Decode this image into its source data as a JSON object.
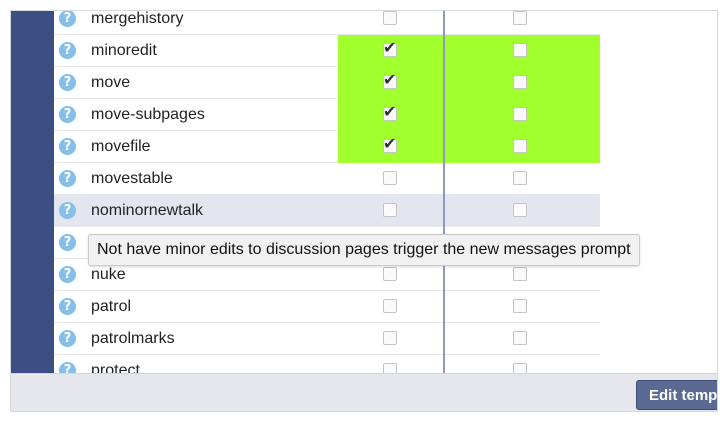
{
  "colors": {
    "granted": "#a1ff2e",
    "sidebar": "#3b4f85",
    "help_icon": "#85bfea"
  },
  "permissions": [
    {
      "name": "mergehistory",
      "col1": false,
      "col2": false,
      "granted": false
    },
    {
      "name": "minoredit",
      "col1": true,
      "col2": false,
      "granted": true
    },
    {
      "name": "move",
      "col1": true,
      "col2": false,
      "granted": true
    },
    {
      "name": "move-subpages",
      "col1": true,
      "col2": false,
      "granted": true
    },
    {
      "name": "movefile",
      "col1": true,
      "col2": false,
      "granted": true
    },
    {
      "name": "movestable",
      "col1": false,
      "col2": false,
      "granted": false
    },
    {
      "name": "nominornewtalk",
      "col1": false,
      "col2": false,
      "granted": false,
      "hover": true
    },
    {
      "name": "",
      "col1": false,
      "col2": false,
      "granted": false
    },
    {
      "name": "nuke",
      "col1": false,
      "col2": false,
      "granted": false
    },
    {
      "name": "patrol",
      "col1": false,
      "col2": false,
      "granted": false
    },
    {
      "name": "patrolmarks",
      "col1": false,
      "col2": false,
      "granted": false
    },
    {
      "name": "protect",
      "col1": false,
      "col2": false,
      "granted": false
    }
  ],
  "help_icon_glyph": "?",
  "help_icon_name": "question-mark-icon",
  "tooltip": "Not have minor edits to discussion pages trigger the new messages prompt",
  "footer": {
    "edit_button": "Edit temp"
  }
}
